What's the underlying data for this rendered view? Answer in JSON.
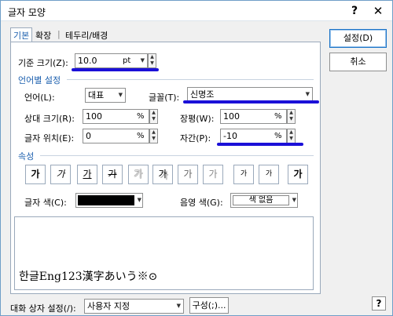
{
  "window": {
    "title": "글자 모양",
    "help_glyph": "?",
    "close_glyph": "✕"
  },
  "tabs": [
    {
      "label": "기본"
    },
    {
      "label": "확장"
    },
    {
      "label": "|"
    },
    {
      "label": "테두리/배경"
    }
  ],
  "base_size": {
    "label": "기준 크기(Z):",
    "value": "10.0",
    "unit": "pt"
  },
  "lang_section": {
    "title": "언어별 설정"
  },
  "language": {
    "label": "언어(L):",
    "value": "대표"
  },
  "font": {
    "label": "글꼴(T):",
    "value": "신명조"
  },
  "relative_size": {
    "label": "상대 크기(R):",
    "value": "100",
    "unit": "%"
  },
  "width_ratio": {
    "label": "장평(W):",
    "value": "100",
    "unit": "%"
  },
  "char_position": {
    "label": "글자 위치(E):",
    "value": "0",
    "unit": "%"
  },
  "char_spacing": {
    "label": "자간(P):",
    "value": "-10",
    "unit": "%"
  },
  "attr_section": {
    "title": "속성"
  },
  "attr_buttons": [
    "가",
    "가",
    "가",
    "가",
    "가",
    "가",
    "가",
    "가",
    "가",
    "가",
    "가"
  ],
  "text_color": {
    "label": "글자 색(C):",
    "color": "#000000"
  },
  "shade_color": {
    "label": "음영 색(G):",
    "value": "색 없음"
  },
  "preview": {
    "text": "한글Eng123漢字あいう※⊙"
  },
  "footer": {
    "label": "대화 상자 설정(/):",
    "value": "사용자 지정",
    "config_label": "구성(;)..."
  },
  "buttons": {
    "ok": "설정(D)",
    "cancel": "취소",
    "help": "?"
  },
  "colors": {
    "accent": "#1b5fae",
    "highlight": "#1b10d8"
  }
}
